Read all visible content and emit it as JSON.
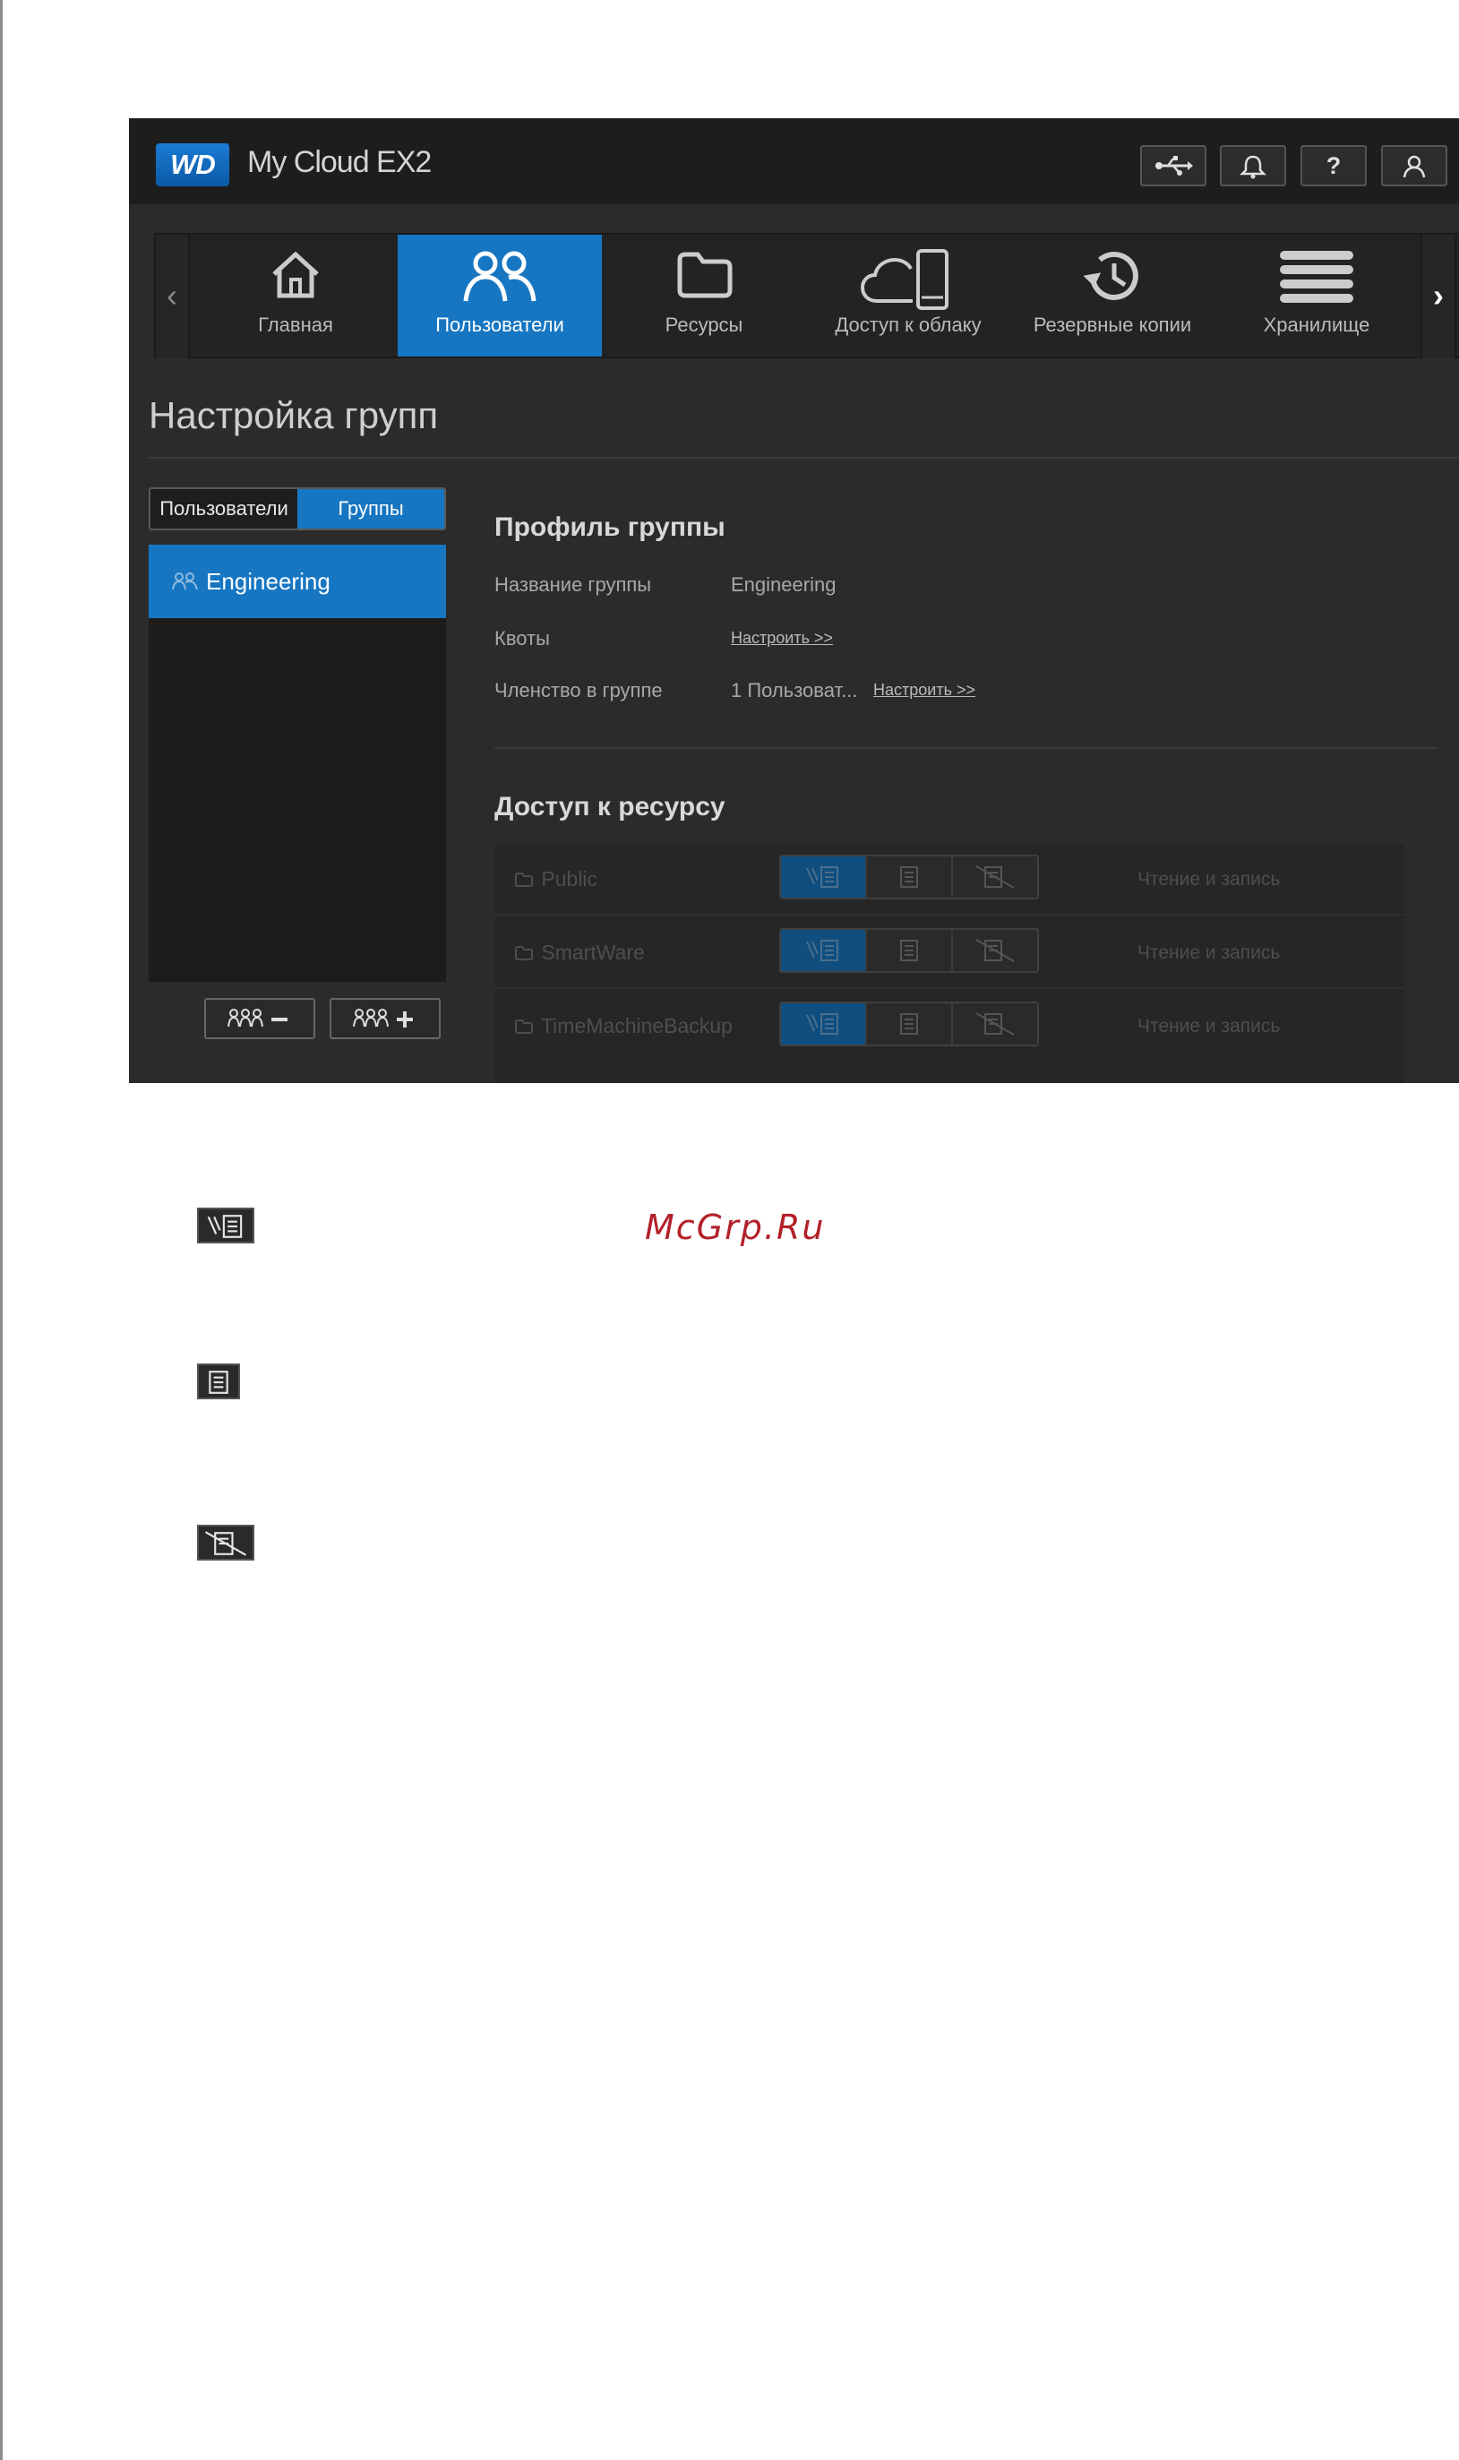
{
  "app": {
    "logo_text": "WD",
    "title": "My Cloud EX2"
  },
  "topbar": {
    "icons": [
      "usb-icon",
      "bell-icon",
      "help-icon",
      "user-icon"
    ],
    "help_label": "?"
  },
  "nav": {
    "left_arrow": "‹",
    "right_arrow": "›",
    "items": [
      {
        "label": "Главная",
        "icon": "home-icon"
      },
      {
        "label": "Пользователи",
        "icon": "users-icon",
        "active": true
      },
      {
        "label": "Ресурсы",
        "icon": "folder-icon"
      },
      {
        "label": "Доступ к облаку",
        "icon": "cloud-phone-icon"
      },
      {
        "label": "Резервные копии",
        "icon": "history-icon"
      },
      {
        "label": "Хранилище",
        "icon": "storage-icon"
      }
    ]
  },
  "page": {
    "title": "Настройка групп"
  },
  "left_panel": {
    "tabs": [
      {
        "label": "Пользователи"
      },
      {
        "label": "Группы",
        "active": true
      }
    ],
    "groups": [
      {
        "name": "Engineering",
        "selected": true
      }
    ]
  },
  "profile": {
    "heading": "Профиль группы",
    "fields": [
      {
        "label": "Название группы",
        "value": "Engineering"
      },
      {
        "label": "Квоты",
        "link": "Настроить >>"
      },
      {
        "label": "Членство в группе",
        "value": "1 Пользоват...",
        "link": "Настроить >>"
      }
    ]
  },
  "share_access": {
    "heading": "Доступ к ресурсу",
    "rows": [
      {
        "name": "Public",
        "status": "Чтение и запись"
      },
      {
        "name": "SmartWare",
        "status": "Чтение и запись"
      },
      {
        "name": "TimeMachineBackup",
        "status": "Чтение и запись"
      }
    ]
  },
  "legend": {
    "icons": [
      "read-write-icon",
      "read-only-icon",
      "no-access-icon"
    ]
  },
  "watermark": "McGrp.Ru",
  "colors": {
    "accent": "#1676c2",
    "background": "#2b2b2b",
    "topbar": "#1d1d1d",
    "watermark": "#b3202a"
  }
}
